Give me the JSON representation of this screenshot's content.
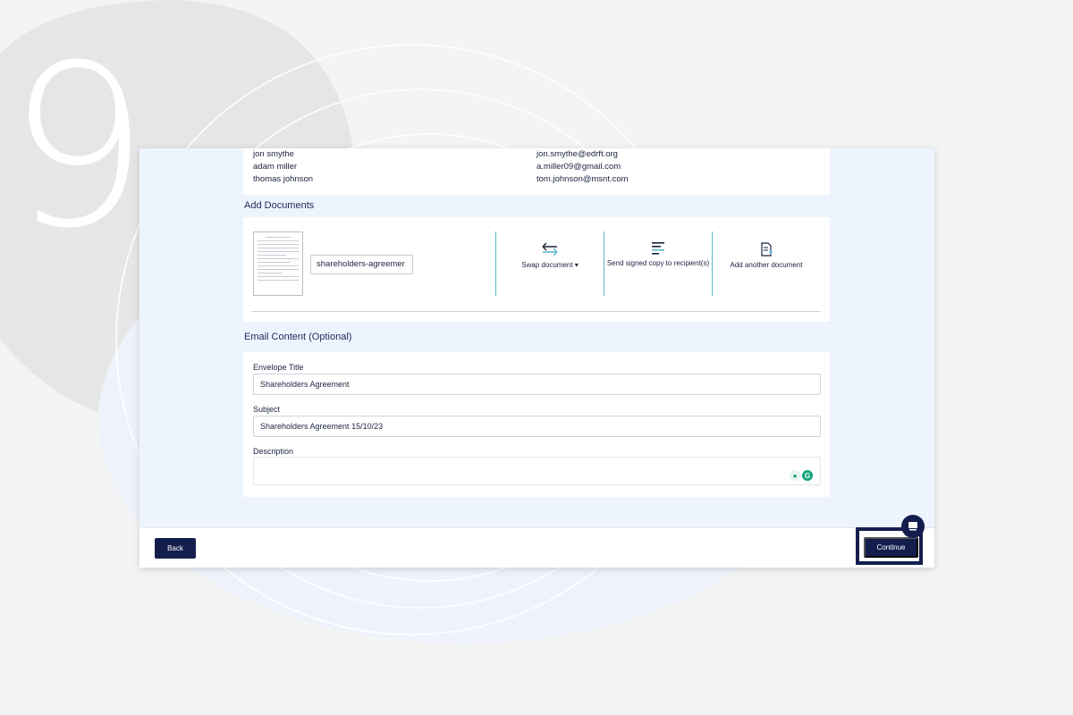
{
  "step_number": "9",
  "recipients": [
    {
      "name": "jon smythe",
      "email": "jon.smythe@edrft.org"
    },
    {
      "name": "adam miller",
      "email": "a.miller09@gmail.com"
    },
    {
      "name": "thomas johnson",
      "email": "tom.johnson@msnt.com"
    }
  ],
  "documents": {
    "title": "Add Documents",
    "file_name": "shareholders-agreemer",
    "actions": {
      "swap": "Swap document ▾",
      "send_copy": "Send signed copy to recipient(s)",
      "add_another": "Add another document"
    }
  },
  "email": {
    "title": "Email Content (Optional)",
    "envelope_title_label": "Envelope Title",
    "envelope_title_value": "Shareholders Agreement",
    "subject_label": "Subject",
    "subject_value": "Shareholders Agreement 15/10/23",
    "description_label": "Description",
    "description_value": ""
  },
  "footer": {
    "back_label": "Back",
    "continue_label": "Continue"
  },
  "colors": {
    "primary": "#141e4d",
    "accent": "#5fb7d4",
    "panel_bg": "#eef4fd"
  }
}
